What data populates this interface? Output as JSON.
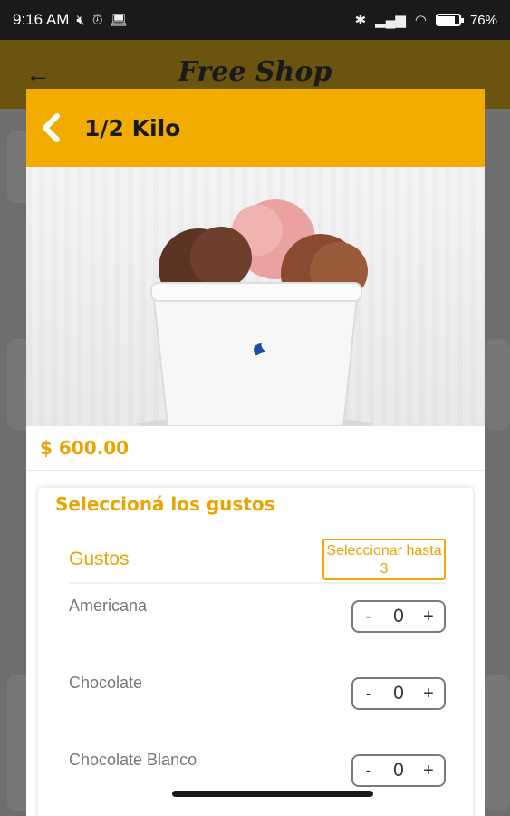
{
  "status_bar": {
    "time": "9:16 AM",
    "battery": "76%",
    "battery_level": 0.76
  },
  "background_app": {
    "title": "Free Shop",
    "back_icon": "arrow-left-icon"
  },
  "modal": {
    "title": "1/2 Kilo",
    "back_icon": "chevron-left-icon",
    "price": "$ 600.00",
    "accent_color": "#f2ac00",
    "options": {
      "heading": "Seleccioná los gustos",
      "group_label": "Gustos",
      "limit_badge": "Seleccionar hasta 3",
      "flavors": [
        {
          "name": "Americana",
          "qty": "0",
          "minus": "-",
          "plus": "+"
        },
        {
          "name": "Chocolate",
          "qty": "0",
          "minus": "-",
          "plus": "+"
        },
        {
          "name": "Chocolate Blanco",
          "qty": "0",
          "minus": "-",
          "plus": "+"
        }
      ]
    }
  }
}
